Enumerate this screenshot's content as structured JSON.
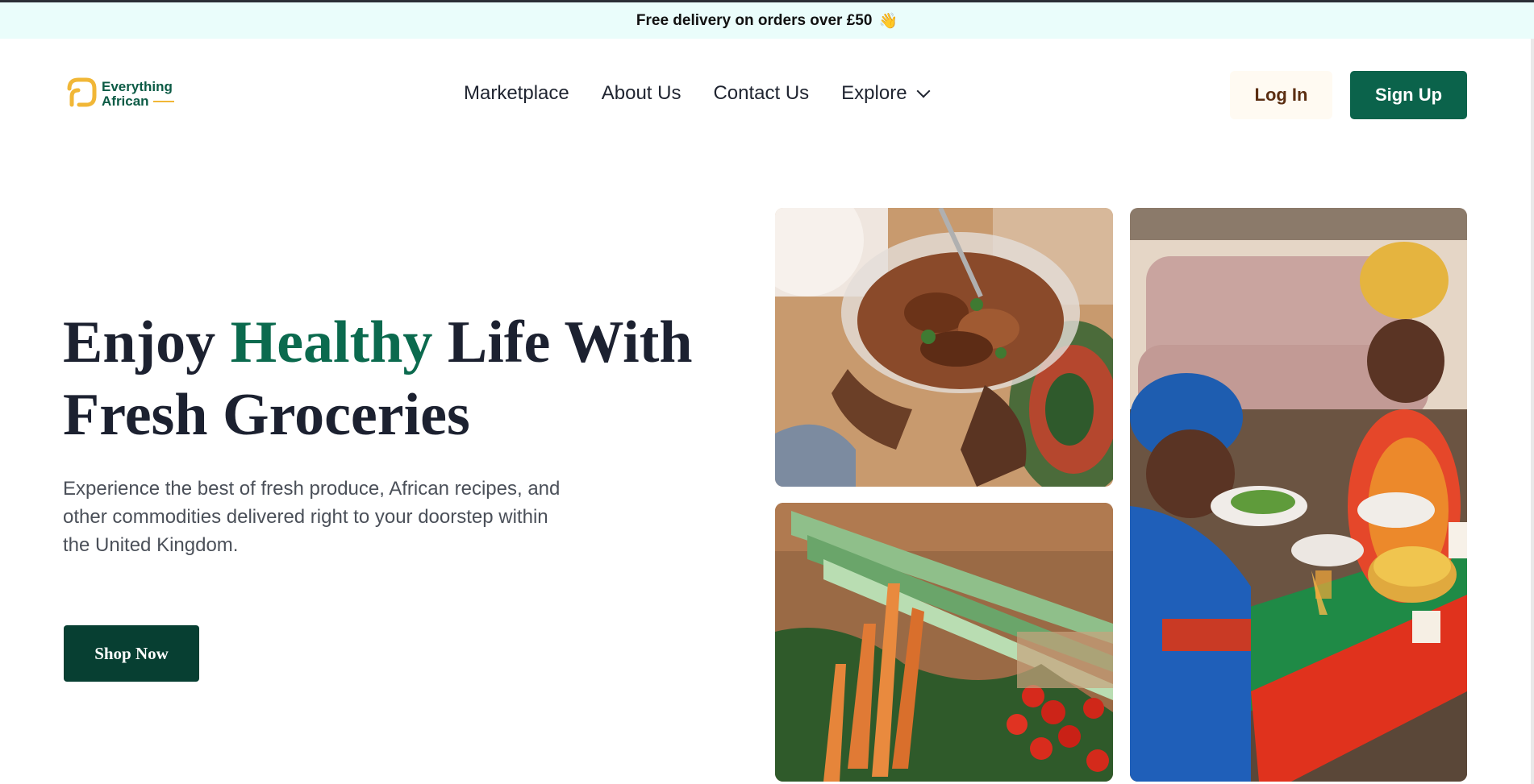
{
  "announcement": {
    "text": "Free delivery on orders over £50",
    "emoji": "👋"
  },
  "brand": {
    "line1": "Everything",
    "line2": "African",
    "primary_color": "#0b634b",
    "accent_color": "#f1b737"
  },
  "nav": {
    "items": [
      "Marketplace",
      "About Us",
      "Contact Us"
    ],
    "explore": "Explore"
  },
  "auth": {
    "login": "Log In",
    "signup": "Sign Up"
  },
  "hero": {
    "title_part1": "Enjoy ",
    "title_accent": "Healthy",
    "title_part2": " Life With Fresh Groceries",
    "subtitle": "Experience the best of fresh produce, African recipes, and other commodities delivered right to your doorstep within the United Kingdom.",
    "cta": "Shop Now"
  },
  "images": [
    {
      "name": "hands-holding-bowl-of-chicken",
      "icon": "photo"
    },
    {
      "name": "fresh-vegetables-carrots-leeks-tomatoes",
      "icon": "photo"
    },
    {
      "name": "family-dining-table",
      "icon": "photo"
    }
  ]
}
